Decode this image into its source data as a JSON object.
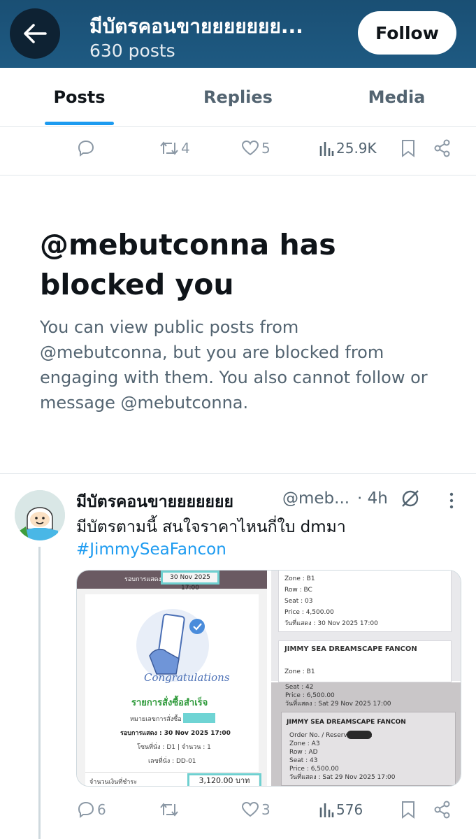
{
  "header": {
    "title": "มีบัตรคอนขายยยยยยย...",
    "subtitle": "630 posts",
    "follow_label": "Follow"
  },
  "tabs": [
    {
      "label": "Posts",
      "active": true
    },
    {
      "label": "Replies",
      "active": false
    },
    {
      "label": "Media",
      "active": false
    }
  ],
  "top_actions": {
    "replies": "",
    "reposts": "4",
    "likes": "5",
    "views": "25.9K"
  },
  "blocked": {
    "title": "@mebutconna has blocked you",
    "message": "You can view public posts from @mebutconna, but you are blocked from engaging with them. You also cannot follow or message @mebutconna."
  },
  "post": {
    "author_name": "มีบัตรคอนขายยยยยยย",
    "handle": "@meb...",
    "separator": "·",
    "time": "4h",
    "text": "มีบัตรตามนี้ สนใจราคาไหนกี่ใบ dmมา",
    "hashtag": "#JimmySeaFancon",
    "media": {
      "left": {
        "banner": "รอบการแสดง",
        "banner_date": "30 Nov 2025 17:00",
        "congrats": "Congratulations",
        "order_success": "รายการสั่งซื้อสำเร็จ",
        "order_no_label": "หมายเลขการสั่งซื้อ :",
        "show_round": "รอบการแสดง : 30 Nov 2025 17:00",
        "zone_qty": "โซนที่นั่ง : D1 | จำนวน : 1",
        "seat_no": "เลขที่นั่ง : DD-01",
        "amount_label": "จำนวนเงินที่ชำระ",
        "amount": "3,120.00 บาท"
      },
      "right_top": {
        "lines": [
          "Zone : B1",
          "Row : BC",
          "Seat : 03",
          "Price : 4,500.00",
          "วันที่แสดง : 30 Nov 2025 17:00"
        ],
        "card_title": "JIMMY SEA DREAMSCAPE FANCON",
        "card_zone": "Zone : B1"
      },
      "right_bottom": {
        "pre_lines": [
          "Seat : 42",
          "Price : 6,500.00",
          "วันที่แสดง : Sat 29 Nov 2025 17:00"
        ],
        "card_title": "JIMMY SEA DREAMSCAPE FANCON",
        "lines": [
          "Order No. / Reserve code :",
          "Zone : A3",
          "Row : AD",
          "Seat : 43",
          "Price : 6,500.00",
          "วันที่แสดง : Sat 29 Nov 2025 17:00"
        ]
      }
    },
    "actions": {
      "replies": "6",
      "reposts": "",
      "likes": "3",
      "views": "576"
    }
  },
  "colors": {
    "header_bg": "#1e5a82",
    "accent": "#1d9bf0",
    "muted": "#536471"
  }
}
